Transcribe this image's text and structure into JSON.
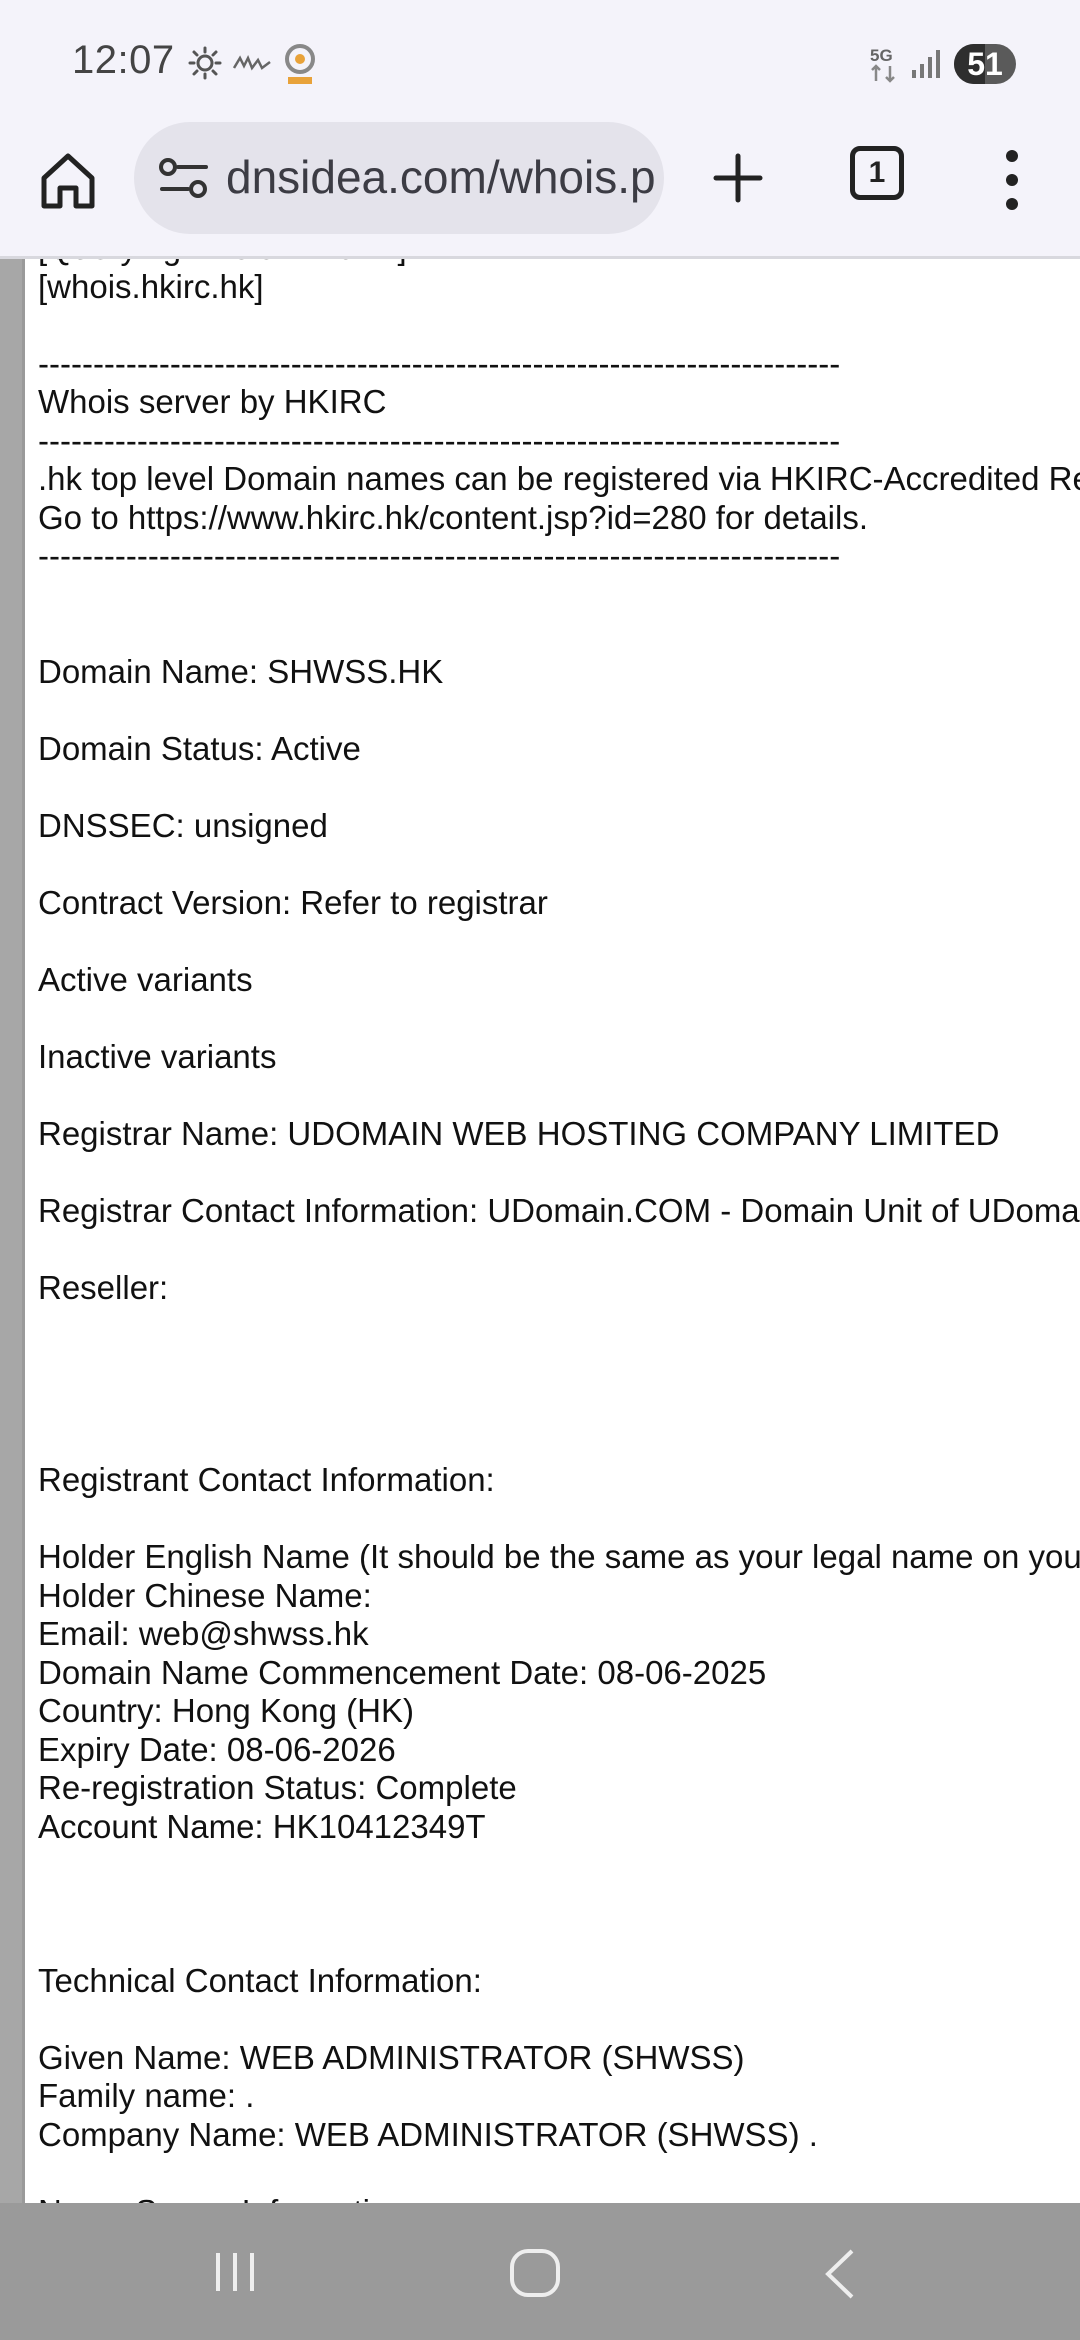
{
  "status_bar": {
    "time": "12:07",
    "network": "5G",
    "battery": "51",
    "notification_icons": [
      "sun-icon",
      "mytv-icon",
      "on-cc-icon"
    ]
  },
  "toolbar": {
    "url": "dnsidea.com/whois.p",
    "tab_count": "1"
  },
  "whois_lines": [
    "[Querying whois.hkirc.hk]",
    "[whois.hkirc.hk]",
    "",
    "-------------------------------------------------------------------------",
    "Whois server by HKIRC",
    "-------------------------------------------------------------------------",
    ".hk top level Domain names can be registered via HKIRC-Accredited Registrars.",
    "Go to https://www.hkirc.hk/content.jsp?id=280 for details.",
    "-------------------------------------------------------------------------",
    "",
    "",
    "Domain Name: SHWSS.HK",
    "",
    "Domain Status: Active",
    "",
    "DNSSEC: unsigned",
    "",
    "Contract Version: Refer to registrar",
    "",
    "Active variants",
    "",
    "Inactive variants",
    "",
    "Registrar Name: UDOMAIN WEB HOSTING COMPANY LIMITED",
    "",
    "Registrar Contact Information: UDomain.COM - Domain Unit of UDomain",
    "",
    "Reseller:",
    "",
    "",
    "",
    "",
    "Registrant Contact Information:",
    "",
    "Holder English Name (It should be the same as your legal name on your",
    "Holder Chinese Name:",
    "Email: web@shwss.hk",
    "Domain Name Commencement Date: 08-06-2025",
    "Country: Hong Kong (HK)",
    "Expiry Date: 08-06-2026",
    "Re-registration Status: Complete",
    "Account Name: HK10412349T",
    "",
    "",
    "",
    "Technical Contact Information:",
    "",
    "Given Name: WEB ADMINISTRATOR (SHWSS)",
    "Family name: .",
    "Company Name: WEB ADMINISTRATOR (SHWSS) .",
    "",
    "Name Server Information:"
  ]
}
